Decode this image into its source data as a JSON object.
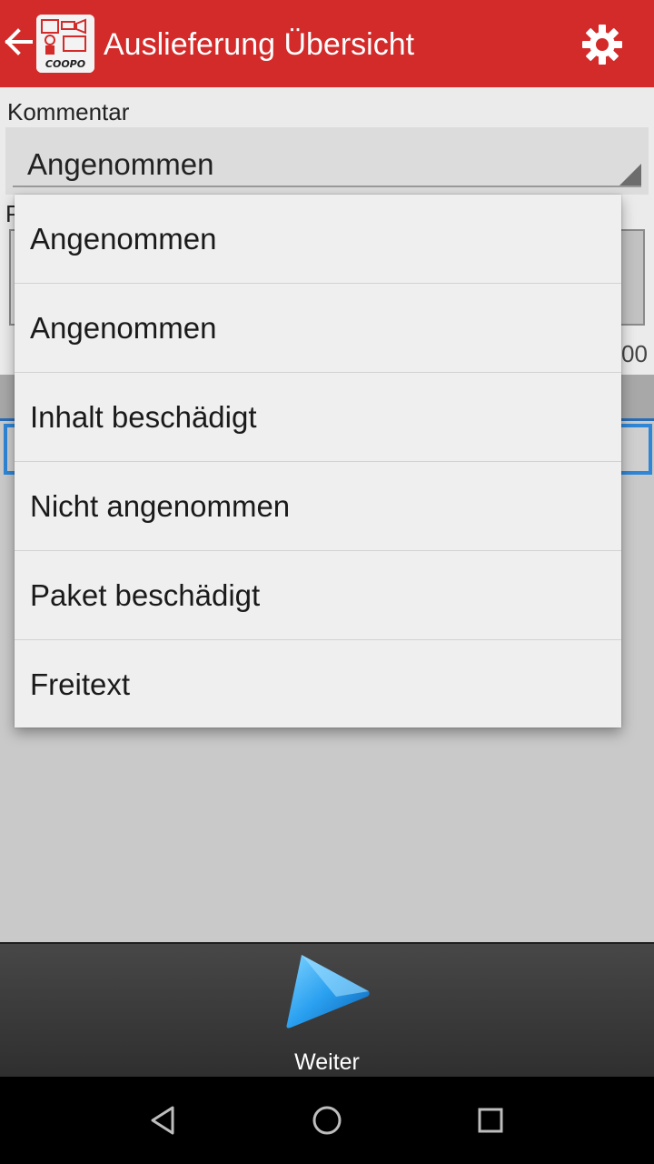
{
  "appbar": {
    "title": "Auslieferung Übersicht",
    "back_icon": "arrow-left-icon",
    "settings_icon": "gear-icon",
    "logo": "app-logo",
    "color": "#d32a2a"
  },
  "form": {
    "kommentar_label": "Kommentar",
    "kommentar_value": "Angenommen",
    "partial_label": "P",
    "partial_number": "00"
  },
  "dropdown": {
    "options": [
      "Angenommen",
      "Angenommen",
      "Inhalt beschädigt",
      "Nicht angenommen",
      "Paket beschädigt",
      "Freitext"
    ]
  },
  "toolbar": {
    "next_label": "Weiter",
    "next_icon": "play-arrow-icon"
  },
  "navbar": {
    "back": "nav-back-icon",
    "home": "nav-home-icon",
    "recents": "nav-recents-icon"
  }
}
